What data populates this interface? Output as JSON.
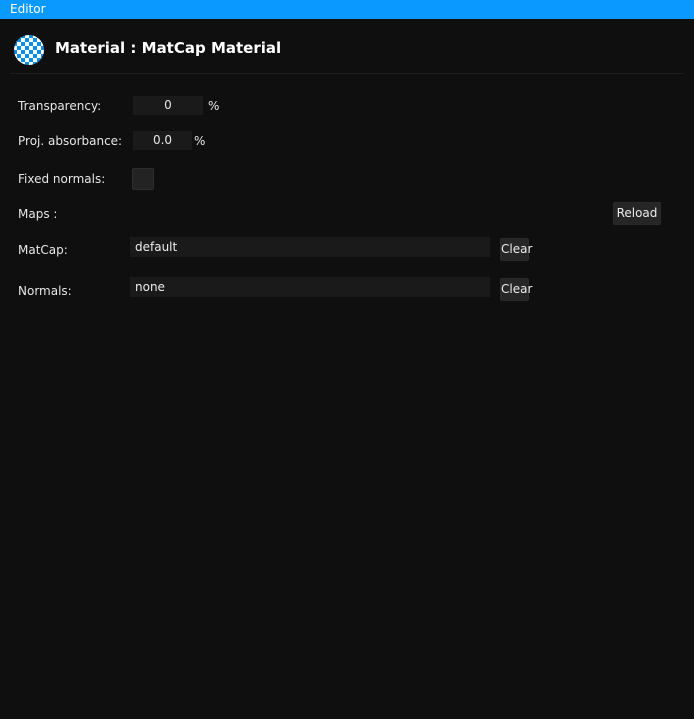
{
  "window": {
    "title": "Editor"
  },
  "header": {
    "title": "Material : MatCap Material",
    "icon": "checkerboard-material-icon",
    "accent_color": "#0a9aff"
  },
  "properties": {
    "transparency": {
      "label": "Transparency:",
      "value": "0",
      "unit": "%"
    },
    "proj_absorbance": {
      "label": "Proj. absorbance:",
      "value": "0.0",
      "unit": "%"
    },
    "fixed_normals": {
      "label": "Fixed normals:",
      "checked": false
    }
  },
  "maps": {
    "label": "Maps :",
    "reload_label": "Reload",
    "matcap": {
      "label": "MatCap:",
      "value": "default",
      "clear_label": "Clear"
    },
    "normals": {
      "label": "Normals:",
      "value": "none",
      "clear_label": "Clear"
    }
  }
}
